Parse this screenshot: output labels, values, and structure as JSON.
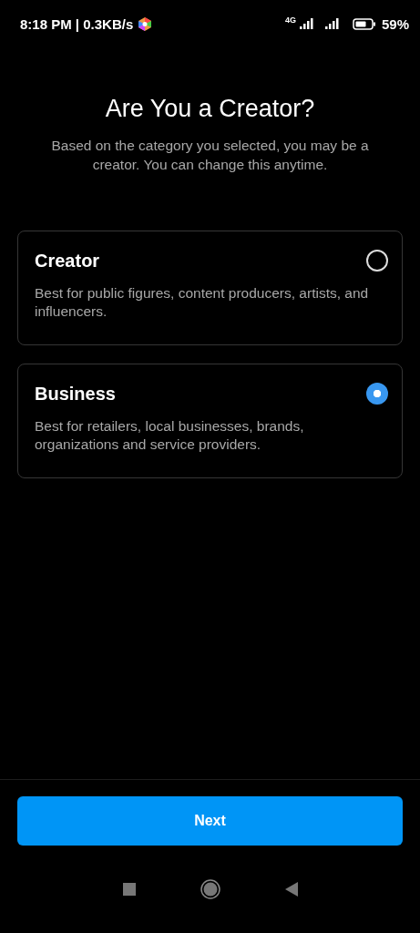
{
  "status_bar": {
    "time": "8:18 PM | 0.3KB/s",
    "network": "4G",
    "battery": "59%"
  },
  "title": "Are You a Creator?",
  "subtitle": "Based on the category you selected, you may be a creator. You can change this anytime.",
  "options": [
    {
      "title": "Creator",
      "description": "Best for public figures, content producers, artists, and influencers.",
      "selected": false
    },
    {
      "title": "Business",
      "description": "Best for retailers, local businesses, brands, organizations and service providers.",
      "selected": true
    }
  ],
  "next_button": "Next"
}
